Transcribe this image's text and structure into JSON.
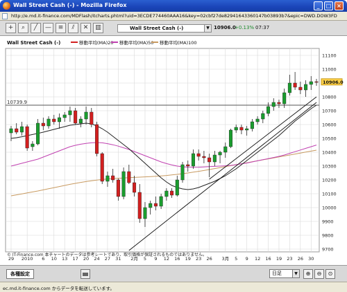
{
  "window": {
    "title": "Wall Street Cash (-) - Mozilla Firefox",
    "url": "http://e.md.it-finance.com/MDFlash/itcharts.phtml?uid=3ECDE774460AAA16&key=02cbf27de82941643360147b03893b7&epic=DWD.DOW3FD.JP&locale=ja_JP&timezone0"
  },
  "toolbar": {
    "instrument": "Wall Street Cash (-)",
    "price": "10906.0",
    "change": "+0.13%",
    "time": "07:37"
  },
  "legend": {
    "main": "Wall Street Cash (-)",
    "ma20": "移動平均(MA)20",
    "ma50": "移動平均(MA)50",
    "ma100": "移動平均(MA)100"
  },
  "hline_label": "10739.9",
  "price_tag": "10906.0",
  "copyright": "© IT-Finance.com 本チャートのデータは参考レートであり、取引価格が保証されるものではありません。",
  "bottom": {
    "settings_label": "各種設定",
    "period": "日足"
  },
  "status": "ec.md.it-finance.com からデータを転送しています。",
  "colors": {
    "up": "#1a9c2e",
    "down": "#d21f1f",
    "ma20": "#222222",
    "ma50": "#c040b0",
    "ma100": "#c89a60",
    "grid": "#d8d8d8"
  },
  "chart_data": {
    "type": "candlestick",
    "y_ticks": [
      9700,
      9800,
      9900,
      10000,
      10100,
      10200,
      10300,
      10400,
      10500,
      10600,
      10700,
      10800,
      10900,
      11000,
      11100
    ],
    "ylim": [
      9680,
      11150
    ],
    "x_ticks": [
      {
        "label": "29",
        "i": 0
      },
      {
        "label": "2010",
        "i": 3
      },
      {
        "label": "6",
        "i": 6
      },
      {
        "label": "10",
        "i": 8
      },
      {
        "label": "13",
        "i": 10
      },
      {
        "label": "17",
        "i": 12
      },
      {
        "label": "20",
        "i": 14
      },
      {
        "label": "24",
        "i": 16
      },
      {
        "label": "27",
        "i": 18
      },
      {
        "label": "31",
        "i": 20
      },
      {
        "label": "2月",
        "i": 23
      },
      {
        "label": "5",
        "i": 25
      },
      {
        "label": "9",
        "i": 27
      },
      {
        "label": "12",
        "i": 29
      },
      {
        "label": "16",
        "i": 31
      },
      {
        "label": "19",
        "i": 33
      },
      {
        "label": "23",
        "i": 35
      },
      {
        "label": "26",
        "i": 37
      },
      {
        "label": "3月",
        "i": 40
      },
      {
        "label": "5",
        "i": 42
      },
      {
        "label": "9",
        "i": 44
      },
      {
        "label": "12",
        "i": 46
      },
      {
        "label": "16",
        "i": 48
      },
      {
        "label": "19",
        "i": 50
      },
      {
        "label": "23",
        "i": 52
      },
      {
        "label": "26",
        "i": 54
      },
      {
        "label": "30",
        "i": 56
      }
    ],
    "hline": 10739.9,
    "candles": [
      {
        "o": 10540,
        "h": 10590,
        "l": 10480,
        "c": 10570
      },
      {
        "o": 10570,
        "h": 10610,
        "l": 10530,
        "c": 10545
      },
      {
        "o": 10545,
        "h": 10620,
        "l": 10520,
        "c": 10585
      },
      {
        "o": 10585,
        "h": 10600,
        "l": 10410,
        "c": 10430
      },
      {
        "o": 10440,
        "h": 10480,
        "l": 10410,
        "c": 10460
      },
      {
        "o": 10460,
        "h": 10640,
        "l": 10450,
        "c": 10610
      },
      {
        "o": 10610,
        "h": 10650,
        "l": 10560,
        "c": 10590
      },
      {
        "o": 10590,
        "h": 10660,
        "l": 10570,
        "c": 10640
      },
      {
        "o": 10640,
        "h": 10670,
        "l": 10600,
        "c": 10620
      },
      {
        "o": 10620,
        "h": 10680,
        "l": 10570,
        "c": 10650
      },
      {
        "o": 10650,
        "h": 10690,
        "l": 10620,
        "c": 10670
      },
      {
        "o": 10670,
        "h": 10730,
        "l": 10620,
        "c": 10700
      },
      {
        "o": 10700,
        "h": 10720,
        "l": 10600,
        "c": 10610
      },
      {
        "o": 10610,
        "h": 10660,
        "l": 10580,
        "c": 10640
      },
      {
        "o": 10640,
        "h": 10730,
        "l": 10600,
        "c": 10690
      },
      {
        "o": 10690,
        "h": 10720,
        "l": 10580,
        "c": 10600
      },
      {
        "o": 10600,
        "h": 10620,
        "l": 10370,
        "c": 10390
      },
      {
        "o": 10390,
        "h": 10400,
        "l": 10170,
        "c": 10190
      },
      {
        "o": 10190,
        "h": 10260,
        "l": 10150,
        "c": 10230
      },
      {
        "o": 10230,
        "h": 10280,
        "l": 10180,
        "c": 10200
      },
      {
        "o": 10200,
        "h": 10210,
        "l": 10050,
        "c": 10080
      },
      {
        "o": 10080,
        "h": 10290,
        "l": 10060,
        "c": 10260
      },
      {
        "o": 10260,
        "h": 10310,
        "l": 10170,
        "c": 10180
      },
      {
        "o": 10180,
        "h": 10230,
        "l": 10080,
        "c": 10110
      },
      {
        "o": 10110,
        "h": 10170,
        "l": 9890,
        "c": 9920
      },
      {
        "o": 9920,
        "h": 10040,
        "l": 9860,
        "c": 10000
      },
      {
        "o": 10000,
        "h": 10050,
        "l": 9950,
        "c": 10030
      },
      {
        "o": 10030,
        "h": 10080,
        "l": 9980,
        "c": 10010
      },
      {
        "o": 10010,
        "h": 10100,
        "l": 9990,
        "c": 10080
      },
      {
        "o": 10080,
        "h": 10140,
        "l": 10050,
        "c": 10120
      },
      {
        "o": 10120,
        "h": 10140,
        "l": 10070,
        "c": 10090
      },
      {
        "o": 10090,
        "h": 10230,
        "l": 10080,
        "c": 10200
      },
      {
        "o": 10200,
        "h": 10330,
        "l": 10180,
        "c": 10310
      },
      {
        "o": 10310,
        "h": 10340,
        "l": 10260,
        "c": 10300
      },
      {
        "o": 10300,
        "h": 10420,
        "l": 10280,
        "c": 10390
      },
      {
        "o": 10390,
        "h": 10420,
        "l": 10340,
        "c": 10370
      },
      {
        "o": 10370,
        "h": 10410,
        "l": 10320,
        "c": 10360
      },
      {
        "o": 10360,
        "h": 10390,
        "l": 10220,
        "c": 10330
      },
      {
        "o": 10330,
        "h": 10410,
        "l": 10300,
        "c": 10380
      },
      {
        "o": 10380,
        "h": 10410,
        "l": 10320,
        "c": 10400
      },
      {
        "o": 10400,
        "h": 10470,
        "l": 10360,
        "c": 10440
      },
      {
        "o": 10440,
        "h": 10570,
        "l": 10430,
        "c": 10560
      },
      {
        "o": 10560,
        "h": 10600,
        "l": 10540,
        "c": 10580
      },
      {
        "o": 10580,
        "h": 10600,
        "l": 10530,
        "c": 10560
      },
      {
        "o": 10560,
        "h": 10590,
        "l": 10520,
        "c": 10570
      },
      {
        "o": 10570,
        "h": 10640,
        "l": 10550,
        "c": 10620
      },
      {
        "o": 10620,
        "h": 10660,
        "l": 10600,
        "c": 10640
      },
      {
        "o": 10640,
        "h": 10700,
        "l": 10610,
        "c": 10680
      },
      {
        "o": 10680,
        "h": 10760,
        "l": 10660,
        "c": 10730
      },
      {
        "o": 10730,
        "h": 10790,
        "l": 10700,
        "c": 10760
      },
      {
        "o": 10760,
        "h": 10780,
        "l": 10720,
        "c": 10750
      },
      {
        "o": 10750,
        "h": 10860,
        "l": 10720,
        "c": 10830
      },
      {
        "o": 10830,
        "h": 10960,
        "l": 10810,
        "c": 10900
      },
      {
        "o": 10900,
        "h": 10980,
        "l": 10850,
        "c": 10870
      },
      {
        "o": 10870,
        "h": 10910,
        "l": 10820,
        "c": 10850
      },
      {
        "o": 10850,
        "h": 10920,
        "l": 10800,
        "c": 10890
      },
      {
        "o": 10890,
        "h": 10950,
        "l": 10850,
        "c": 10910
      },
      {
        "o": 10910,
        "h": 10930,
        "l": 10880,
        "c": 10906
      }
    ],
    "ma20": [
      10500,
      10505,
      10512,
      10520,
      10528,
      10536,
      10545,
      10555,
      10565,
      10575,
      10585,
      10595,
      10600,
      10605,
      10610,
      10605,
      10590,
      10570,
      10545,
      10515,
      10485,
      10455,
      10425,
      10390,
      10355,
      10320,
      10285,
      10250,
      10215,
      10185,
      10160,
      10145,
      10135,
      10130,
      10135,
      10145,
      10160,
      10175,
      10190,
      10210,
      10230,
      10255,
      10280,
      10310,
      10340,
      10370,
      10400,
      10430,
      10460,
      10490,
      10520,
      10555,
      10590,
      10625,
      10655,
      10685,
      10715,
      10740
    ],
    "ma50": [
      10300,
      10310,
      10320,
      10330,
      10340,
      10350,
      10365,
      10380,
      10395,
      10410,
      10425,
      10440,
      10450,
      10458,
      10464,
      10468,
      10470,
      10468,
      10462,
      10454,
      10444,
      10432,
      10420,
      10405,
      10390,
      10375,
      10360,
      10345,
      10330,
      10318,
      10308,
      10300,
      10295,
      10292,
      10291,
      10292,
      10294,
      10296,
      10298,
      10300,
      10302,
      10305,
      10310,
      10316,
      10322,
      10330,
      10338,
      10346,
      10354,
      10362,
      10370,
      10380,
      10392,
      10404,
      10416,
      10428,
      10440,
      10452
    ],
    "ma100": [
      10085,
      10092,
      10099,
      10106,
      10113,
      10120,
      10128,
      10136,
      10144,
      10152,
      10160,
      10168,
      10175,
      10182,
      10188,
      10194,
      10199,
      10203,
      10207,
      10210,
      10212,
      10214,
      10216,
      10218,
      10220,
      10222,
      10224,
      10226,
      10229,
      10232,
      10236,
      10240,
      10245,
      10250,
      10256,
      10262,
      10268,
      10275,
      10282,
      10289,
      10296,
      10303,
      10310,
      10317,
      10324,
      10331,
      10338,
      10345,
      10352,
      10359,
      10366,
      10373,
      10380,
      10387,
      10394,
      10401,
      10408,
      10415
    ],
    "trendlines": [
      {
        "i1": 22,
        "v1": 9690,
        "i2": 57,
        "v2": 10760
      },
      {
        "i1": 37,
        "v1": 10205,
        "i2": 57,
        "v2": 10800
      }
    ]
  }
}
